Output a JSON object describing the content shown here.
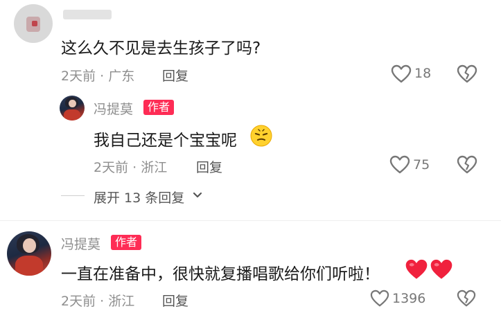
{
  "comment1": {
    "text": "这么久不见是去生孩子了吗?",
    "time_location": "2天前 · 广东",
    "reply_label": "回复",
    "likes": "18"
  },
  "reply1": {
    "author": "冯提莫",
    "badge": "作者",
    "text": "我自己还是个宝宝呢",
    "emoji": "smirk-emoji",
    "time_location": "2天前 · 浙江",
    "reply_label": "回复",
    "likes": "75"
  },
  "expand": {
    "label": "展开 13 条回复"
  },
  "comment2": {
    "author": "冯提莫",
    "badge": "作者",
    "text": "一直在准备中，很快就复播唱歌给你们听啦！",
    "time_location": "2天前 · 浙江",
    "reply_label": "回复",
    "likes": "1396"
  },
  "colors": {
    "badge": "#fe2c55",
    "heart_emoji": "#f0213d",
    "meta_gray": "#8e8e8e"
  },
  "icons": {
    "like": "heart-outline-icon",
    "dislike": "broken-heart-icon",
    "expand": "chevron-down-icon"
  }
}
